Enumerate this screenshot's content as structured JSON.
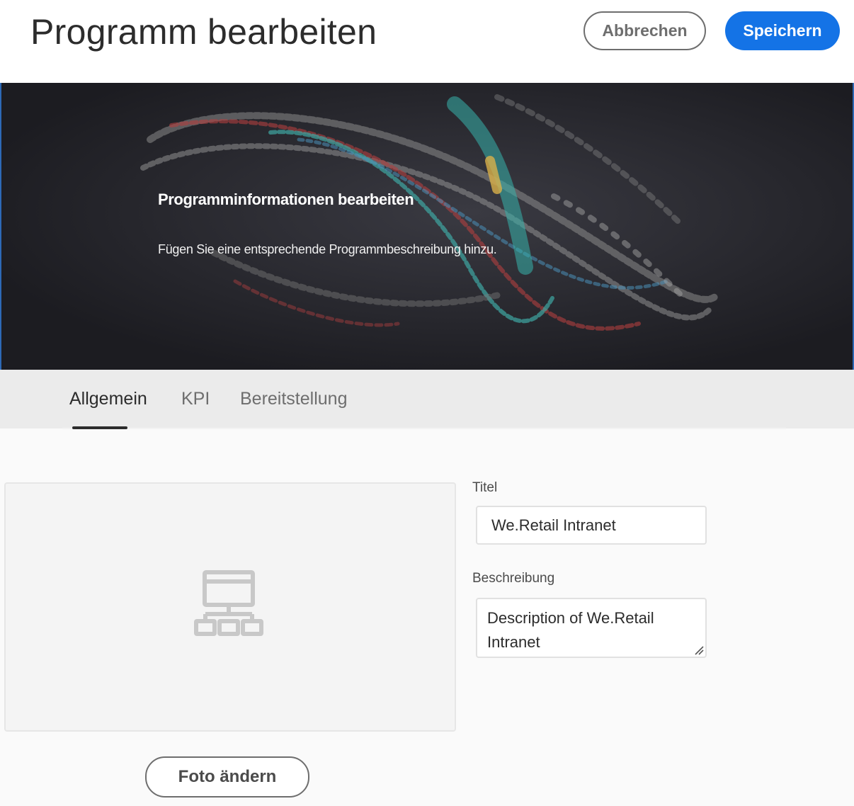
{
  "header": {
    "title": "Programm bearbeiten",
    "cancel_label": "Abbrechen",
    "save_label": "Speichern"
  },
  "banner": {
    "title": "Programminformationen bearbeiten",
    "subtitle": "Fügen Sie eine entsprechende Programmbeschreibung hinzu."
  },
  "tabs": [
    {
      "label": "Allgemein",
      "active": true
    },
    {
      "label": "KPI",
      "active": false
    },
    {
      "label": "Bereitstellung",
      "active": false
    }
  ],
  "thumbnail": {
    "icon": "sitemap-icon",
    "change_photo_label": "Foto ändern"
  },
  "form": {
    "title_label": "Titel",
    "title_value": "We.Retail Intranet",
    "description_label": "Beschreibung",
    "description_value": "Description of We.Retail Intranet"
  },
  "colors": {
    "accent": "#1473e6",
    "tabbar_bg": "#ebebeb",
    "banner_bg": "#222227"
  }
}
